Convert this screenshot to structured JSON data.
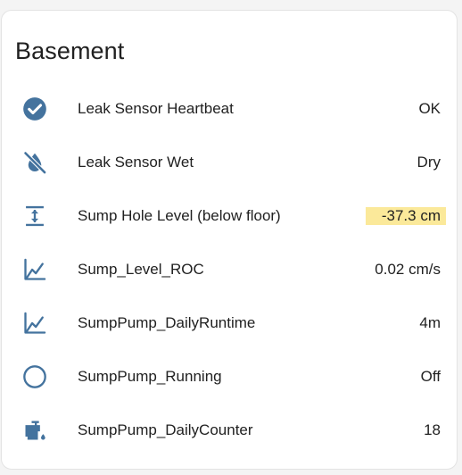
{
  "card": {
    "title": "Basement",
    "icon_color": "#44739e",
    "rows": [
      {
        "icon": "check-circle-icon",
        "label": "Leak Sensor Heartbeat",
        "value": "OK"
      },
      {
        "icon": "water-off-icon",
        "label": "Leak Sensor Wet",
        "value": "Dry"
      },
      {
        "icon": "arrow-expand-vertical-icon",
        "label": "Sump Hole Level (below floor)",
        "value": "-37.3 cm",
        "highlighted": true,
        "highlight_color": "#fbe99a"
      },
      {
        "icon": "chart-line-icon",
        "label": "Sump_Level_ROC",
        "value": "0.02 cm/s"
      },
      {
        "icon": "chart-line-icon",
        "label": "SumpPump_DailyRuntime",
        "value": "4m"
      },
      {
        "icon": "circle-outline-icon",
        "label": "SumpPump_Running",
        "value": "Off"
      },
      {
        "icon": "water-pump-icon",
        "label": "SumpPump_DailyCounter",
        "value": "18"
      }
    ]
  }
}
